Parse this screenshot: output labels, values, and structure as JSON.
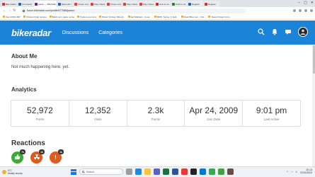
{
  "browser": {
    "tabs": [
      {
        "label": "Bike Radar",
        "color": "#d32f2f"
      },
      {
        "label": "(4 unread)",
        "color": "#1565c0"
      },
      {
        "label": "yahoo — BikeRadar",
        "color": "#6a1b9a"
      },
      {
        "label": "Muscular f",
        "color": "#1565c0",
        "active": true
      },
      {
        "label": "Chess: Ano",
        "color": "#e53935"
      },
      {
        "label": "Play Chess",
        "color": "#e53935"
      },
      {
        "label": "Chess: Ano",
        "color": "#e53935"
      },
      {
        "label": "Play Chess",
        "color": "#e53935"
      },
      {
        "label": "Play Chess",
        "color": "#e53935"
      },
      {
        "label": "How to mo",
        "color": "#c62828"
      },
      {
        "label": "Profi.co.uk",
        "color": "#2e7d32"
      },
      {
        "label": "Register",
        "color": "#1565c0"
      },
      {
        "label": "Register",
        "color": "#d32f2f"
      }
    ],
    "address": "forum.bikeradar.com/profile/677586/jadom",
    "bookmarks": [
      "Intel 1993-1997",
      "Chicken thigh receipe",
      "Baldi curry paste recipe",
      "Parkers economy",
      "Butter Chicken (Murgh...",
      "Eid Makhani - Cook...",
      "BMW_Series_3_Estl...",
      "Road Bike.com - Onli...",
      "Sweet Potato Curry..."
    ]
  },
  "site": {
    "logo": "bikeradar",
    "nav": [
      "Discussions",
      "Categories"
    ]
  },
  "about": {
    "title": "About Me",
    "text": "Not much happening here, yet."
  },
  "analytics": {
    "title": "Analytics",
    "stats": [
      {
        "value": "52,972",
        "label": "Posts"
      },
      {
        "value": "12,352",
        "label": "Visits"
      },
      {
        "value": "2.3k",
        "label": "Points"
      },
      {
        "value": "Apr 24, 2009",
        "label": "Join Date"
      },
      {
        "value": "9:01 pm",
        "label": "Last Active"
      }
    ]
  },
  "reactions": {
    "title": "Reactions",
    "badges": [
      {
        "icon": "thumbs-up-icon",
        "count": "7k",
        "color": "#3aaa35"
      },
      {
        "icon": "radiation-icon",
        "count": "1k",
        "color": "#e05a1e"
      },
      {
        "icon": "exclamation-icon",
        "count": "1k",
        "color": "#e05a1e"
      }
    ]
  },
  "taskbar": {
    "weather_temp": "4°C",
    "weather_desc": "Mostly cloudy",
    "search_placeholder": "Search",
    "time": "20:13",
    "date": "22/01/2023"
  }
}
